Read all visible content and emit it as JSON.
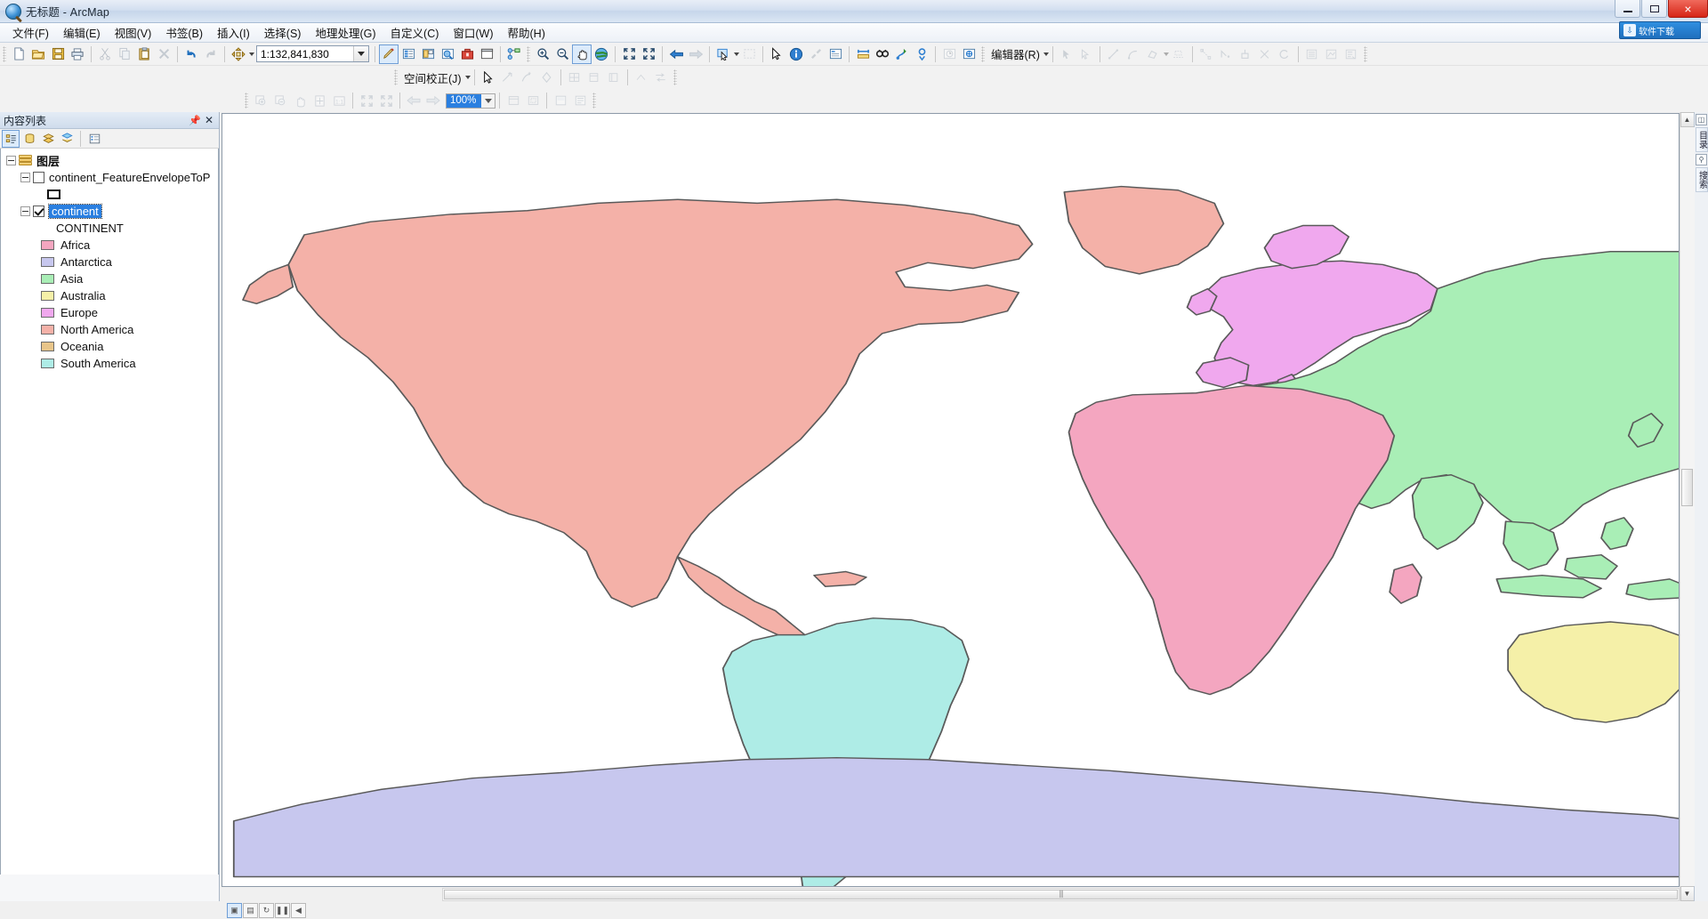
{
  "window": {
    "title": "无标题 - ArcMap",
    "app_icon": "arcmap-globe-icon",
    "minimize_label": "最小化",
    "maximize_label": "最大化",
    "close_label": "×"
  },
  "menubar": {
    "items": [
      {
        "label": "文件(F)",
        "name": "menu-file"
      },
      {
        "label": "编辑(E)",
        "name": "menu-edit"
      },
      {
        "label": "视图(V)",
        "name": "menu-view"
      },
      {
        "label": "书签(B)",
        "name": "menu-bookmarks"
      },
      {
        "label": "插入(I)",
        "name": "menu-insert"
      },
      {
        "label": "选择(S)",
        "name": "menu-selection"
      },
      {
        "label": "地理处理(G)",
        "name": "menu-geoprocessing"
      },
      {
        "label": "自定义(C)",
        "name": "menu-customize"
      },
      {
        "label": "窗口(W)",
        "name": "menu-window"
      },
      {
        "label": "帮助(H)",
        "name": "menu-help"
      }
    ]
  },
  "banner": {
    "text": "软件下载",
    "icon": "download-icon"
  },
  "toolbar_standard": {
    "scale_value": "1:132,841,830",
    "scale_placeholder": "1:132,841,830",
    "buttons": [
      "new-document-icon",
      "open-document-icon",
      "save-icon",
      "print-icon",
      "cut-icon",
      "copy-icon",
      "paste-icon",
      "delete-icon",
      "undo-icon",
      "redo-icon",
      "add-data-icon",
      "editor-toolbar-icon",
      "table-of-contents-icon",
      "catalog-icon",
      "search-icon",
      "arctoolbox-icon",
      "python-window-icon",
      "model-builder-icon"
    ]
  },
  "toolbar_tools": {
    "buttons": [
      "zoom-in-icon",
      "zoom-out-icon",
      "pan-icon",
      "full-extent-icon",
      "fixed-zoom-in-icon",
      "fixed-zoom-out-icon",
      "go-back-extent-icon",
      "go-next-extent-icon",
      "select-features-icon",
      "clear-selection-icon",
      "select-elements-icon",
      "identify-icon",
      "hyperlink-icon",
      "html-popup-icon",
      "measure-icon",
      "find-icon",
      "find-route-icon",
      "xy-locate-icon",
      "time-slider-icon",
      "create-viewer-icon"
    ]
  },
  "toolbar_editor": {
    "label": "编辑器(R)",
    "buttons": [
      "edit-tool-icon",
      "edit-annotation-icon",
      "straight-segment-icon",
      "arc-segment-icon",
      "trace-icon",
      "construction-dropdown-icon",
      "edit-vertices-icon",
      "reshape-feature-icon",
      "cut-polygons-icon",
      "split-icon",
      "rotate-icon",
      "attributes-icon",
      "sketch-properties-icon",
      "create-features-icon"
    ]
  },
  "toolbar_spatial_adjustment": {
    "label": "空间校正(J)",
    "buttons": [
      "select-elements-icon",
      "new-displacement-link-icon",
      "new-identity-link-icon",
      "new-multipoint-link-icon",
      "view-link-table-icon",
      "open-attribute-table-icon",
      "link-table-icon",
      "adjust-icon",
      "attribute-transfer-icon"
    ]
  },
  "toolbar_layout": {
    "zoom_value": "100%",
    "buttons": [
      "layout-zoom-in-icon",
      "layout-zoom-out-icon",
      "layout-pan-icon",
      "zoom-whole-page-icon",
      "zoom-100-icon",
      "fixed-zoom-in-icon",
      "fixed-zoom-out-icon",
      "go-back-extent-icon",
      "go-next-extent-icon",
      "toggle-draft-mode-icon",
      "focus-data-frame-icon",
      "change-layout-icon",
      "data-driven-pages-icon"
    ]
  },
  "toc": {
    "title": "内容列表",
    "pin_icon": "pin-icon",
    "close_icon": "close-icon",
    "tool_buttons": [
      "list-by-drawing-order-icon",
      "list-by-source-icon",
      "list-by-visibility-icon",
      "list-by-selection-icon",
      "options-icon"
    ],
    "root": {
      "label": "图层",
      "icon": "layers-icon"
    },
    "layers": [
      {
        "name": "continent_FeatureEnvelopeToP",
        "checked": false,
        "selected": false,
        "symbol_type": "hollow-rectangle",
        "symbol_fill": "#ffffff",
        "symbol_stroke": "#111111"
      },
      {
        "name": "continent",
        "checked": true,
        "selected": true,
        "field_label": "CONTINENT",
        "classes": [
          {
            "label": "Africa",
            "color": "#f4a6c0"
          },
          {
            "label": "Antarctica",
            "color": "#c7c7ee"
          },
          {
            "label": "Asia",
            "color": "#a9eeb6"
          },
          {
            "label": "Australia",
            "color": "#f5f0a8"
          },
          {
            "label": "Europe",
            "color": "#f0a8ee"
          },
          {
            "label": "North America",
            "color": "#f4b1a8"
          },
          {
            "label": "Oceania",
            "color": "#e8c58a"
          },
          {
            "label": "South America",
            "color": "#aeece6"
          }
        ]
      }
    ]
  },
  "map": {
    "background": "#ffffff",
    "border": "#8d9aa8",
    "continent_colors": {
      "north_america": "#f4b1a8",
      "south_america": "#aeece6",
      "europe": "#f0a8ee",
      "asia": "#a9eeb6",
      "africa": "#f4a6c0",
      "australia": "#f5f0a8",
      "antarctica": "#c7c7ee",
      "oceania": "#e8c58a",
      "outline": "#5a5a5a"
    }
  },
  "statusbar": {
    "buttons": [
      "data-view-icon",
      "layout-view-icon",
      "refresh-icon",
      "pause-drawing-icon"
    ],
    "scroll_left_icon": "chevron-left-icon",
    "scroll_right_icon": "chevron-right-icon"
  },
  "right_dock": {
    "tabs": [
      "目录",
      "搜索"
    ],
    "icons": [
      "catalog-icon",
      "search-icon"
    ]
  }
}
